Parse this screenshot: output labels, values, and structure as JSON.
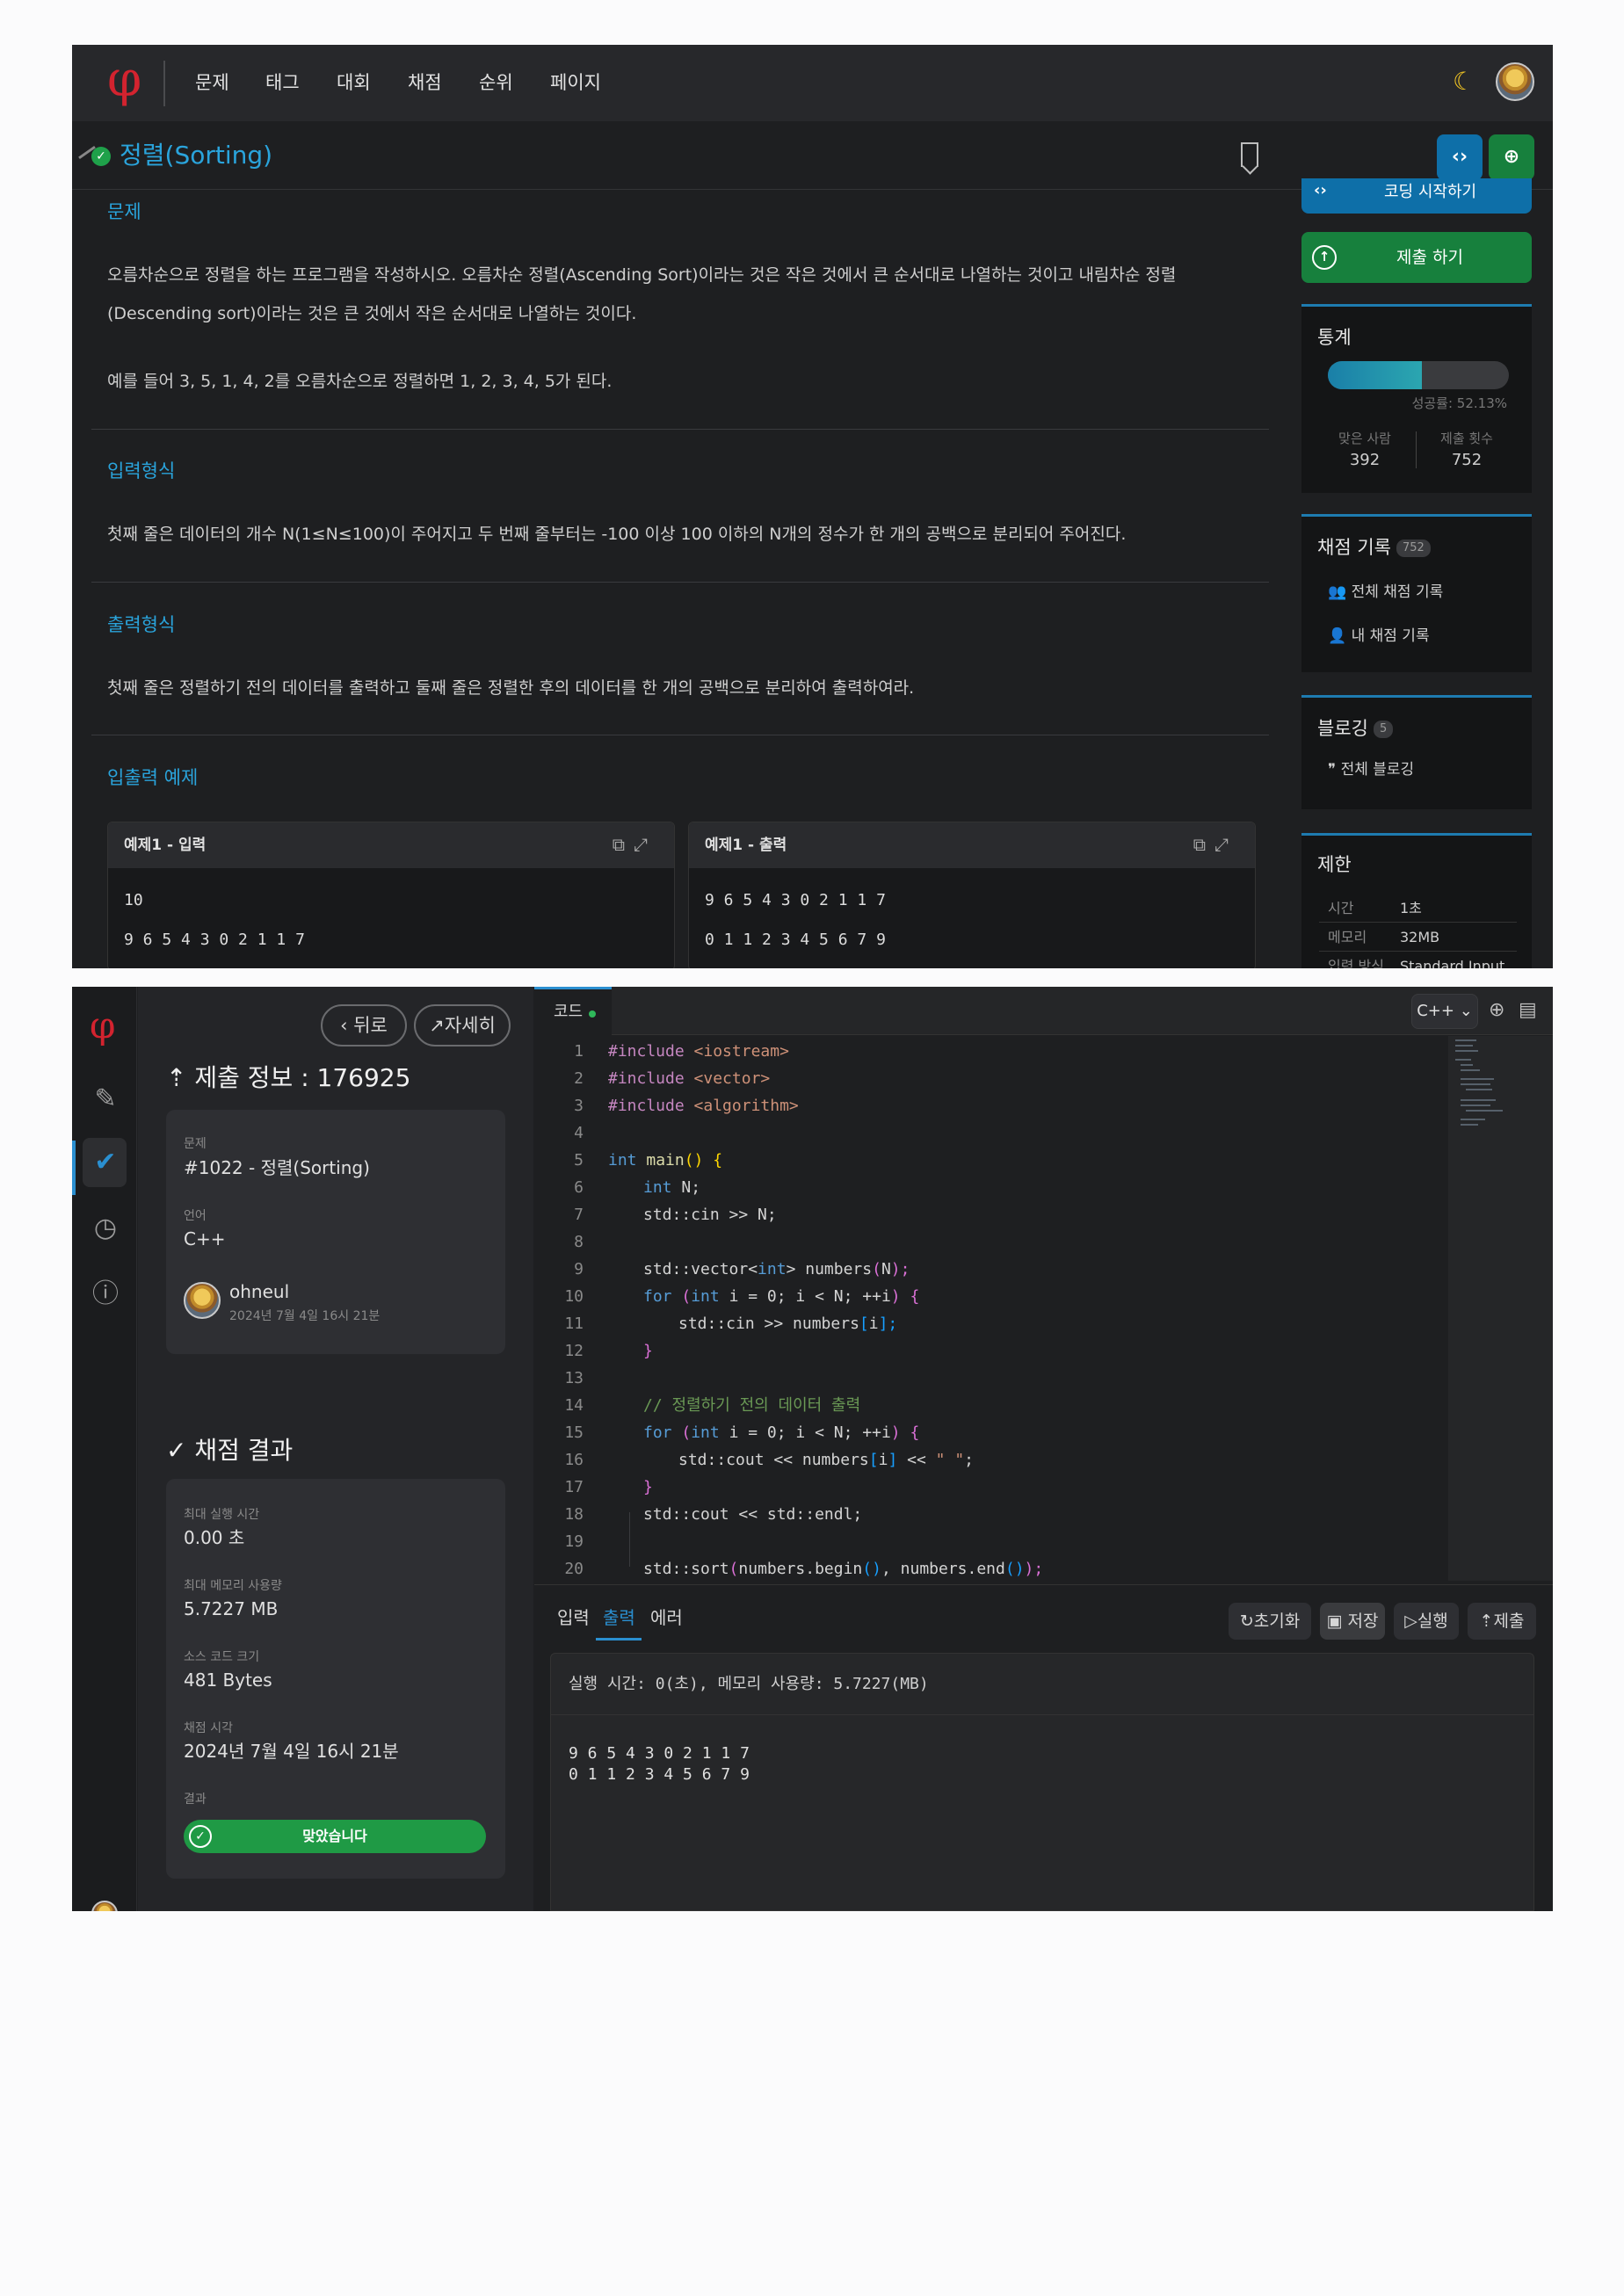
{
  "nav": {
    "items": [
      "문제",
      "태그",
      "대회",
      "채점",
      "순위",
      "페이지"
    ]
  },
  "problem": {
    "title": "정렬(Sorting)",
    "section_problem": "문제",
    "desc_line1": "오름차순으로 정렬을 하는 프로그램을 작성하시오. 오름차순 정렬(Ascending Sort)이라는 것은 작은 것에서 큰 순서대로 나열하는 것이고 내림차순 정렬",
    "desc_line2": "(Descending sort)이라는 것은 큰 것에서 작은 순서대로 나열하는 것이다.",
    "desc_line3": "예를 들어 3, 5, 1, 4, 2를 오름차순으로 정렬하면 1, 2, 3, 4, 5가 된다.",
    "section_input": "입력형식",
    "input_desc": "첫째 줄은 데이터의 개수 N(1≤N≤100)이 주어지고 두 번째 줄부터는 -100 이상 100 이하의 N개의 정수가 한 개의 공백으로 분리되어 주어진다.",
    "section_output": "출력형식",
    "output_desc": "첫째 줄은 정렬하기 전의 데이터를 출력하고 둘째 줄은 정렬한 후의 데이터를 한 개의 공백으로 분리하여 출력하여라.",
    "section_examples": "입출력 예제",
    "sample_input": {
      "title": "예제1 - 입력",
      "line1": "10",
      "line2": "9 6 5 4 3 0 2 1 1 7"
    },
    "sample_output": {
      "title": "예제1 - 출력",
      "line1": "9 6 5 4 3 0 2 1 1 7",
      "line2": "0 1 1 2 3 4 5 6 7 9"
    }
  },
  "sidebar": {
    "start_coding": "코딩 시작하기",
    "submit": "제출 하기",
    "stats": {
      "title": "통계",
      "success_rate": "성공률: 52.13%",
      "rate_value": 0.5213,
      "solved_label": "맞은 사람",
      "solved_value": "392",
      "submit_label": "제출 횟수",
      "submit_value": "752"
    },
    "records": {
      "title": "채점 기록",
      "count": "752",
      "all": "전체 채점 기록",
      "mine": "내 채점 기록"
    },
    "blog": {
      "title": "블로깅",
      "count": "5",
      "all": "전체 블로깅"
    },
    "limits": {
      "title": "제한",
      "time_label": "시간",
      "time_value": "1초",
      "memory_label": "메모리",
      "memory_value": "32MB",
      "input_label": "입력 방식",
      "input_value": "Standard Input"
    }
  },
  "submission": {
    "back": "뒤로",
    "detail": "자세히",
    "heading": "제출 정보 : 176925",
    "problem_label": "문제",
    "problem_value": "#1022 - 정렬(Sorting)",
    "lang_label": "언어",
    "lang_value": "C++",
    "user_name": "ohneul",
    "user_date": "2024년 7월 4일 16시 21분",
    "result_heading": "채점 결과",
    "max_time_label": "최대 실행 시간",
    "max_time_value": "0.00 초",
    "max_mem_label": "최대 메모리 사용량",
    "max_mem_value": "5.7227 MB",
    "code_size_label": "소스 코드 크기",
    "code_size_value": "481 Bytes",
    "judge_time_label": "채점 시각",
    "judge_time_value": "2024년 7월 4일 16시 21분",
    "result_label": "결과",
    "result_value": "맞았습니다"
  },
  "editor": {
    "tab_label": "코드",
    "language": "C++",
    "line_numbers": [
      "1",
      "2",
      "3",
      "4",
      "5",
      "6",
      "7",
      "8",
      "9",
      "10",
      "11",
      "12",
      "13",
      "14",
      "15",
      "16",
      "17",
      "18",
      "19",
      "20"
    ],
    "code": {
      "l1_a": "#include",
      "l1_b": "<iostream>",
      "l2_a": "#include",
      "l2_b": "<vector>",
      "l3_a": "#include",
      "l3_b": "<algorithm>",
      "l5_a": "int",
      "l5_b": "main",
      "l5_c": "()",
      "l5_d": "{",
      "l6_a": "int",
      "l6_b": "N;",
      "l7": "std::cin >> N;",
      "l9_a": "std::vector<",
      "l9_b": "int",
      "l9_c": "> numbers",
      "l9_d": "(",
      "l9_e": "N",
      "l9_f": ");",
      "l10_a": "for",
      "l10_b": "(",
      "l10_c": "int",
      "l10_d": "i = 0; i < N; ++i",
      "l10_e": ")",
      "l10_f": "{",
      "l11_a": "std::cin >> numbers",
      "l11_b": "[",
      "l11_c": "i",
      "l11_d": "];",
      "l12": "}",
      "l14": "// 정렬하기 전의 데이터 출력",
      "l15_a": "for",
      "l15_b": "(",
      "l15_c": "int",
      "l15_d": "i = 0; i < N; ++i",
      "l15_e": ")",
      "l15_f": "{",
      "l16_a": "std::cout << numbers",
      "l16_b": "[",
      "l16_c": "i",
      "l16_d": "]",
      "l16_e": " << ",
      "l16_f": "\" \"",
      "l16_g": ";",
      "l17": "}",
      "l18": "std::cout << std::endl;",
      "l20_a": "std::sort",
      "l20_b": "(",
      "l20_c": "numbers.begin",
      "l20_d": "()",
      "l20_e": ", numbers.end",
      "l20_f": "()",
      "l20_g": ");"
    },
    "io_tabs": [
      "입력",
      "출력",
      "에러"
    ],
    "actions": {
      "reset": "초기화",
      "save": "저장",
      "run": "실행",
      "submit": "제출"
    },
    "run_status": "실행 시간: 0(초), 메모리 사용량: 5.7227(MB)",
    "output_line1": "9 6 5 4 3 0 2 1 1 7",
    "output_line2": "0 1 1 2 3 4 5 6 7 9"
  },
  "icons": {
    "logo": "φ",
    "moon": "moon-icon",
    "bookmark": "bookmark-icon",
    "code": "code-icon",
    "upload": "upload-icon"
  }
}
